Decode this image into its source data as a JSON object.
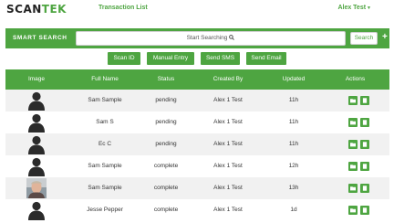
{
  "brand": {
    "name_part1": "SCAN",
    "name_part2": "TEK"
  },
  "nav": {
    "transaction_list": "Transaction List"
  },
  "user": {
    "name": "Alex Test"
  },
  "search": {
    "label": "SMART SEARCH",
    "placeholder": "Start Searching",
    "button": "Search",
    "add": "+"
  },
  "actions": {
    "scan_id": "Scan ID",
    "manual_entry": "Manual Entry",
    "send_sms": "Send SMS",
    "send_email": "Send Email"
  },
  "table": {
    "headers": {
      "image": "Image",
      "full_name": "Full Name",
      "status": "Status",
      "created_by": "Created By",
      "updated": "Updated",
      "actions": "Actions"
    },
    "rows": [
      {
        "full_name": "Sam Sample",
        "status": "pending",
        "created_by": "Alex 1 Test",
        "updated": "11h",
        "avatar": "silhouette-icon"
      },
      {
        "full_name": "Sam S",
        "status": "pending",
        "created_by": "Alex 1 Test",
        "updated": "11h",
        "avatar": "silhouette-icon"
      },
      {
        "full_name": "Ec C",
        "status": "pending",
        "created_by": "Alex 1 Test",
        "updated": "11h",
        "avatar": "silhouette-icon"
      },
      {
        "full_name": "Sam Sample",
        "status": "complete",
        "created_by": "Alex 1 Test",
        "updated": "12h",
        "avatar": "silhouette-icon"
      },
      {
        "full_name": "Sam Sample",
        "status": "complete",
        "created_by": "Alex 1 Test",
        "updated": "13h",
        "avatar": "photo"
      },
      {
        "full_name": "Jesse Pepper",
        "status": "complete",
        "created_by": "Alex 1 Test",
        "updated": "1d",
        "avatar": "silhouette-icon"
      }
    ],
    "row_action_icons": [
      "folder-open-icon",
      "document-icon"
    ]
  },
  "colors": {
    "accent": "#4ea541",
    "row_alt": "#f1f1f1"
  }
}
